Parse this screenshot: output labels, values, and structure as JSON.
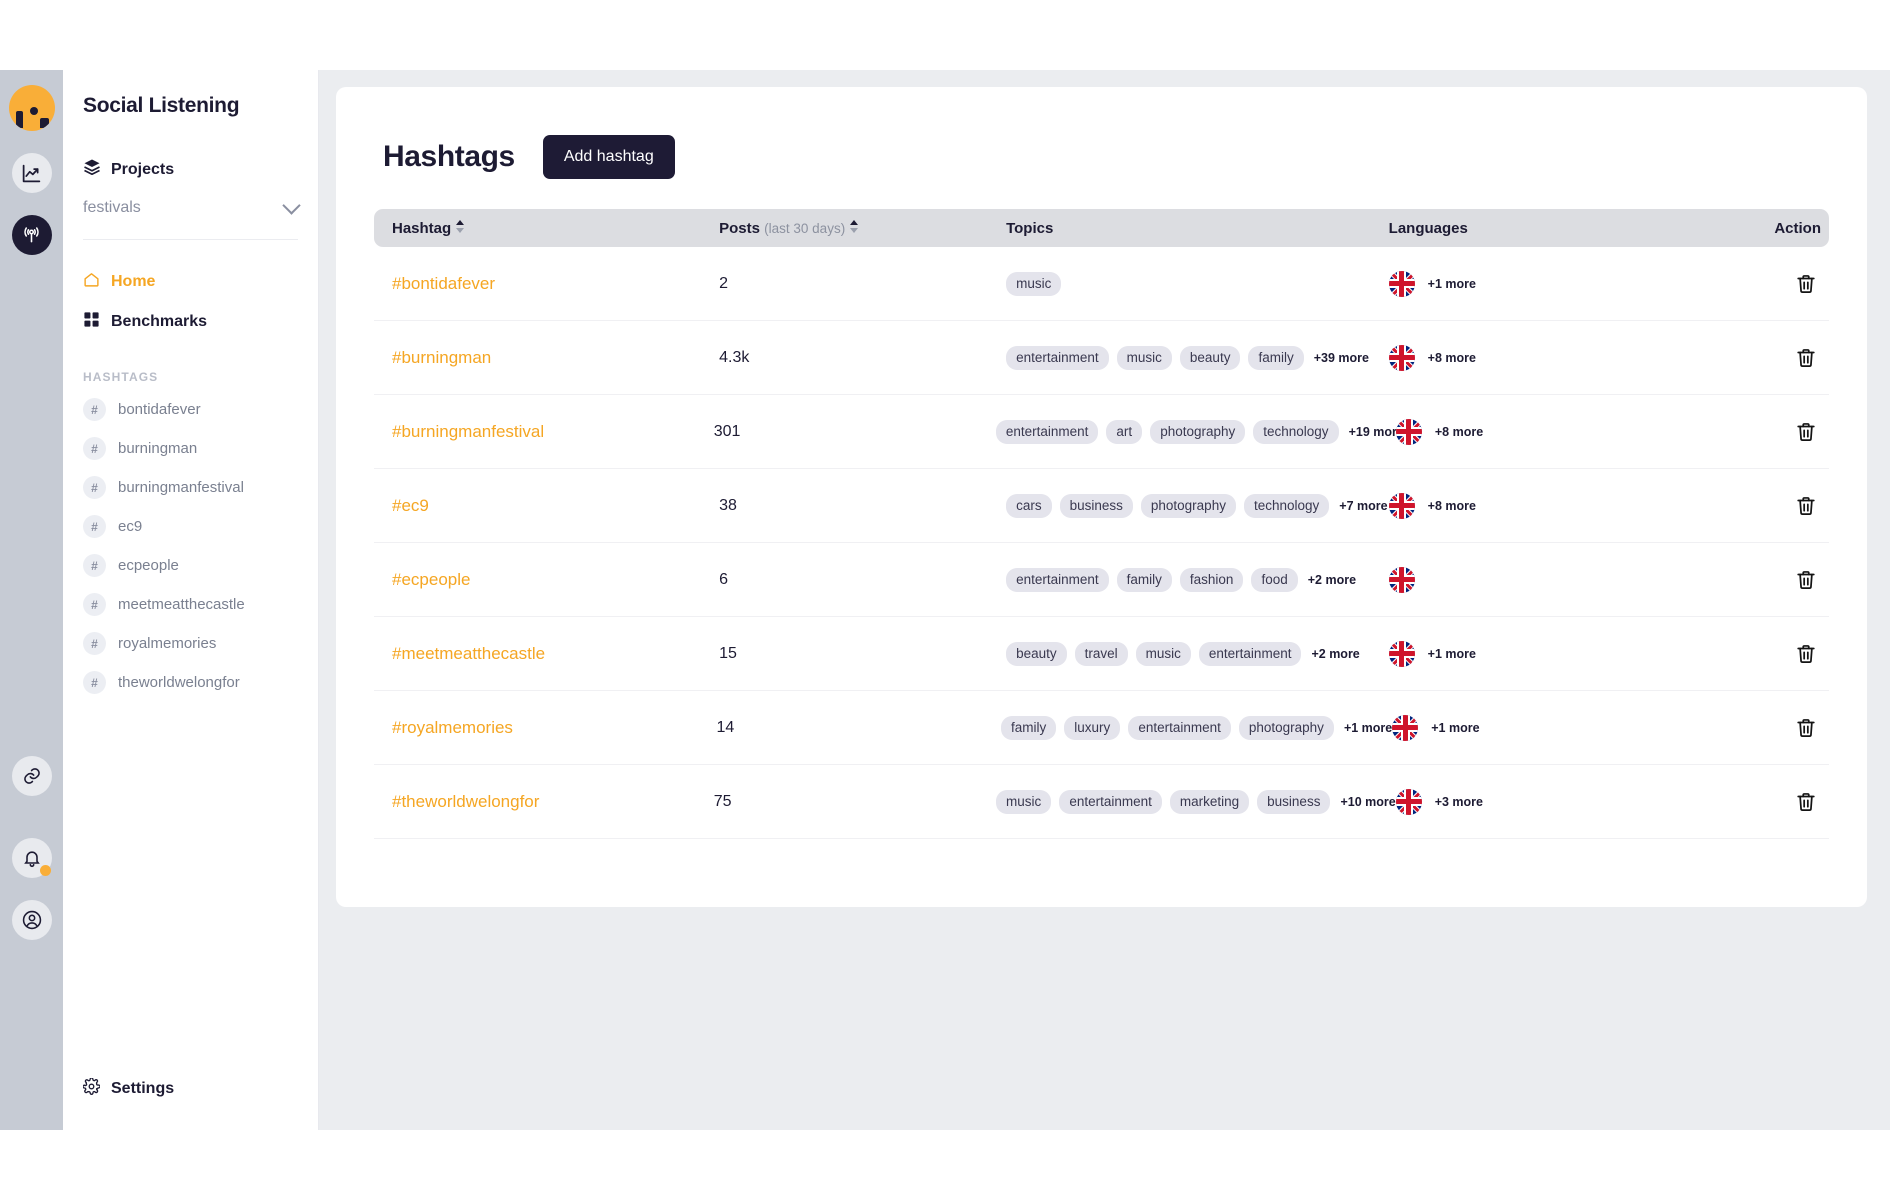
{
  "rail": {
    "logo_name": "app-logo",
    "buttons": [
      {
        "name": "analytics-icon",
        "style": "light"
      },
      {
        "name": "broadcast-icon",
        "style": "dark"
      }
    ],
    "bottom_buttons": [
      {
        "name": "link-icon",
        "style": "light",
        "badge": false
      },
      {
        "name": "bell-icon",
        "style": "light",
        "badge": true
      },
      {
        "name": "account-icon",
        "style": "light",
        "badge": false
      }
    ]
  },
  "sidebar": {
    "title": "Social Listening",
    "projects_label": "Projects",
    "project_selected": "festivals",
    "nav": [
      {
        "label": "Home",
        "icon": "home-icon",
        "active": true
      },
      {
        "label": "Benchmarks",
        "icon": "grid-icon",
        "active": false
      }
    ],
    "hashtags_section_label": "HASHTAGS",
    "hashtags": [
      "bontidafever",
      "burningman",
      "burningmanfestival",
      "ec9",
      "ecpeople",
      "meetmeatthecastle",
      "royalmemories",
      "theworldwelongfor"
    ],
    "settings_label": "Settings"
  },
  "main": {
    "page_title": "Hashtags",
    "add_button": "Add hashtag",
    "table": {
      "columns": {
        "hashtag": "Hashtag",
        "posts": "Posts",
        "posts_sub": "(last 30 days)",
        "topics": "Topics",
        "languages": "Languages",
        "action": "Action"
      },
      "rows": [
        {
          "hashtag": "#bontidafever",
          "posts": "2",
          "topics": [
            "music"
          ],
          "topics_more": "",
          "flags": [
            "uk"
          ],
          "langs_more": "+1 more",
          "action_icon": "trash-icon"
        },
        {
          "hashtag": "#burningman",
          "posts": "4.3k",
          "topics": [
            "entertainment",
            "music",
            "beauty",
            "family"
          ],
          "topics_more": "+39 more",
          "flags": [
            "uk"
          ],
          "langs_more": "+8 more",
          "action_icon": "trash-icon"
        },
        {
          "hashtag": "#burningmanfestival",
          "posts": "301",
          "topics": [
            "entertainment",
            "art",
            "photography",
            "technology"
          ],
          "topics_more": "+19 more",
          "flags": [
            "uk"
          ],
          "langs_more": "+8 more",
          "action_icon": "trash-icon"
        },
        {
          "hashtag": "#ec9",
          "posts": "38",
          "topics": [
            "cars",
            "business",
            "photography",
            "technology"
          ],
          "topics_more": "+7 more",
          "flags": [
            "uk"
          ],
          "langs_more": "+8 more",
          "action_icon": "trash-icon"
        },
        {
          "hashtag": "#ecpeople",
          "posts": "6",
          "topics": [
            "entertainment",
            "family",
            "fashion",
            "food"
          ],
          "topics_more": "+2 more",
          "flags": [
            "uk"
          ],
          "langs_more": "",
          "action_icon": "trash-icon"
        },
        {
          "hashtag": "#meetmeatthecastle",
          "posts": "15",
          "topics": [
            "beauty",
            "travel",
            "music",
            "entertainment"
          ],
          "topics_more": "+2 more",
          "flags": [
            "uk"
          ],
          "langs_more": "+1 more",
          "action_icon": "trash-icon"
        },
        {
          "hashtag": "#royalmemories",
          "posts": "14",
          "topics": [
            "family",
            "luxury",
            "entertainment",
            "photography"
          ],
          "topics_more": "+1 more",
          "flags": [
            "uk"
          ],
          "langs_more": "+1 more",
          "action_icon": "trash-icon"
        },
        {
          "hashtag": "#theworldwelongfor",
          "posts": "75",
          "topics": [
            "music",
            "entertainment",
            "marketing",
            "business"
          ],
          "topics_more": "+10 more",
          "flags": [
            "uk"
          ],
          "langs_more": "+3 more",
          "action_icon": "trash-icon"
        }
      ]
    }
  },
  "colors": {
    "accent": "#f5a623",
    "dark": "#1d1b33",
    "rail_bg": "#c6cbd4",
    "page_bg": "#ebedf0",
    "chip_bg": "#e4e4ec",
    "header_bg": "#dcdde1"
  }
}
